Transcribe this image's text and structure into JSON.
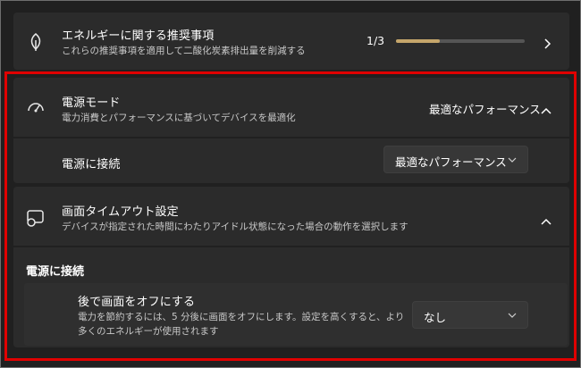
{
  "recommendation": {
    "icon": "leaf-icon",
    "title": "エネルギーに関する推奨事項",
    "subtitle": "これらの推奨事項を適用して二酸化炭素排出量を削減する",
    "progress_text": "1/3",
    "progress_fraction": 0.34,
    "progress_color": "#c5a66b"
  },
  "power_mode": {
    "icon": "gauge-icon",
    "title": "電源モード",
    "subtitle": "電力消費とパフォーマンスに基づいてデバイスを最適化",
    "current_value": "最適なパフォーマンス",
    "plugged_in_label": "電源に接続",
    "plugged_in_value": "最適なパフォーマンス"
  },
  "screen_timeout": {
    "icon": "screen-timeout-icon",
    "title": "画面タイムアウト設定",
    "subtitle": "デバイスが指定された時間にわたりアイドル状態になった場合の動作を選択します",
    "section_heading": "電源に接続",
    "option_title": "後で画面をオフにする",
    "option_desc_line1": "電力を節約するには、5 分後に画面をオフにします。設定を高くすると、より",
    "option_desc_line2": "多くのエネルギーが使用されます",
    "option_value": "なし"
  },
  "colors": {
    "background": "#202020",
    "card": "#2b2b2b",
    "highlight": "#e00000"
  }
}
